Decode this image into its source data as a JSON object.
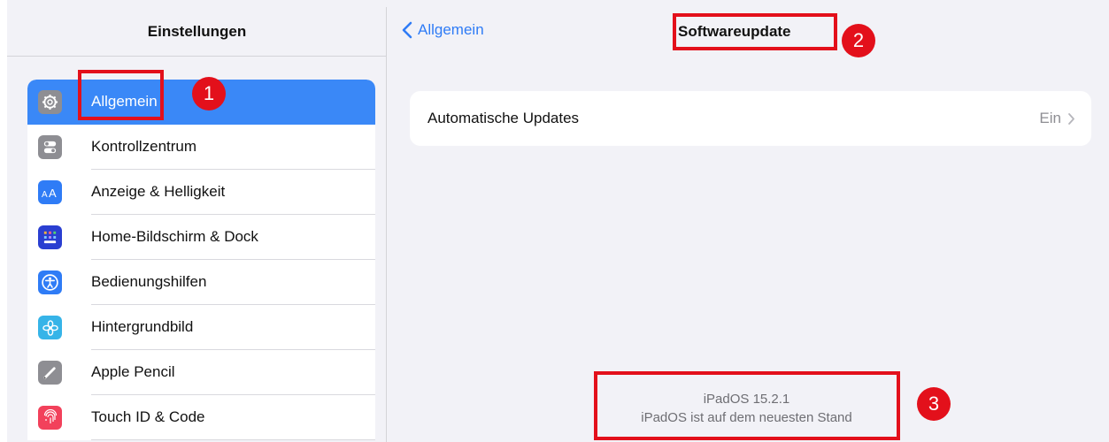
{
  "sidebar": {
    "title": "Einstellungen",
    "items": [
      {
        "label": "Allgemein",
        "icon": "gear-icon",
        "color": "#8e8e93",
        "selected": true
      },
      {
        "label": "Kontrollzentrum",
        "icon": "switches-icon",
        "color": "#8e8e93"
      },
      {
        "label": "Anzeige & Helligkeit",
        "icon": "text-size-icon",
        "color": "#2f7cf6"
      },
      {
        "label": "Home-Bildschirm & Dock",
        "icon": "app-grid-icon",
        "color": "#2a3fd1"
      },
      {
        "label": "Bedienungshilfen",
        "icon": "accessibility-icon",
        "color": "#2f7cf6"
      },
      {
        "label": "Hintergrundbild",
        "icon": "flower-icon",
        "color": "#36b4e8"
      },
      {
        "label": "Apple Pencil",
        "icon": "pencil-icon",
        "color": "#8e8e93"
      },
      {
        "label": "Touch ID & Code",
        "icon": "fingerprint-icon",
        "color": "#f2415b"
      }
    ]
  },
  "detail": {
    "back_label": "Allgemein",
    "title": "Softwareupdate",
    "auto_updates": {
      "label": "Automatische Updates",
      "value": "Ein"
    },
    "version": {
      "name": "iPadOS 15.2.1",
      "status": "iPadOS ist auf dem neuesten Stand"
    }
  },
  "annotations": {
    "badge_1": "1",
    "badge_2": "2",
    "badge_3": "3",
    "color": "#e3101b"
  }
}
